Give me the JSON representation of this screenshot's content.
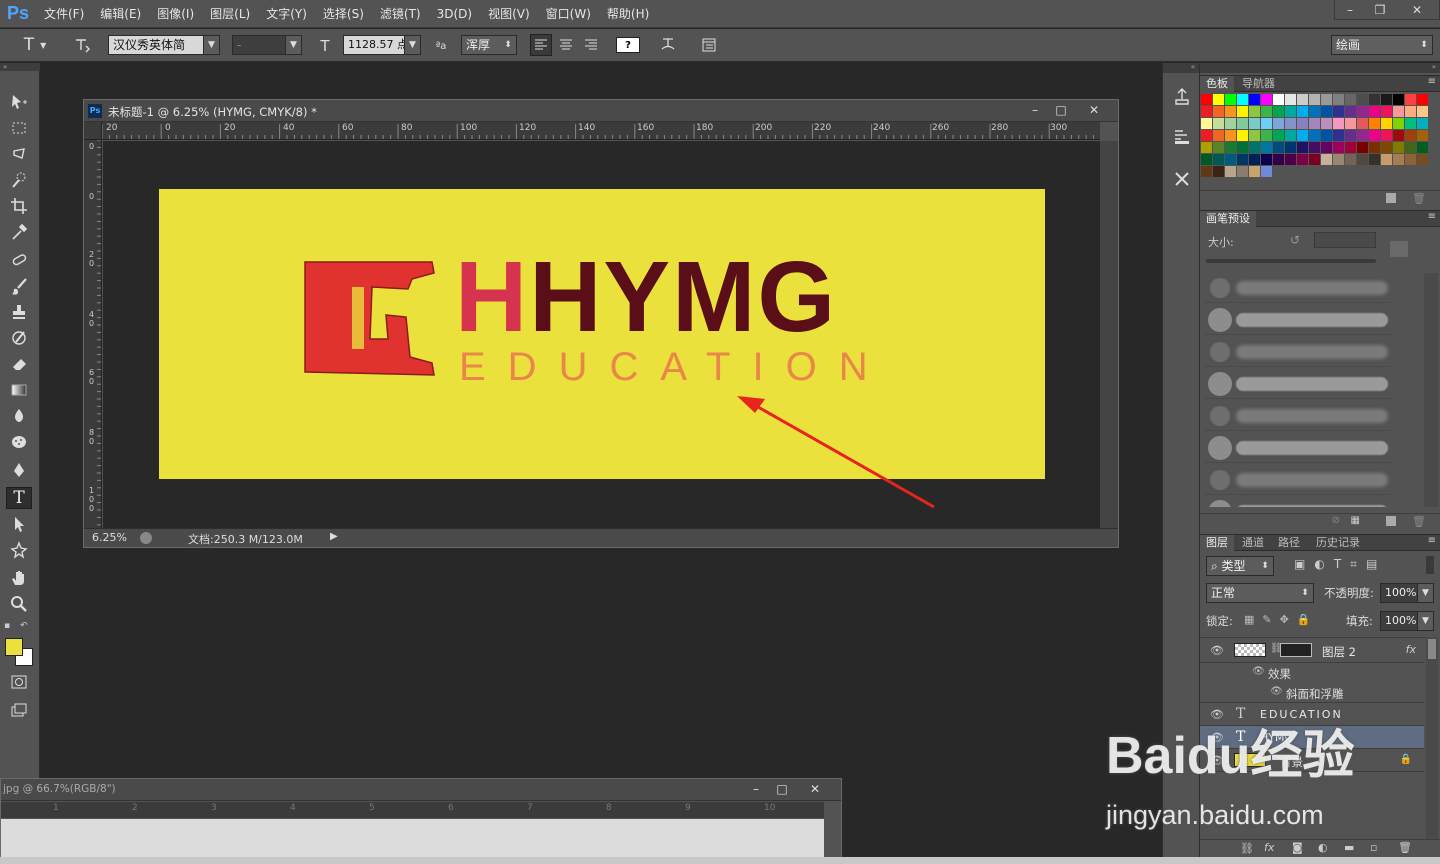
{
  "app": {
    "logo": "Ps",
    "menu": [
      "文件(F)",
      "编辑(E)",
      "图像(I)",
      "图层(L)",
      "文字(Y)",
      "选择(S)",
      "滤镜(T)",
      "3D(D)",
      "视图(V)",
      "窗口(W)",
      "帮助(H)"
    ],
    "window_controls": [
      "–",
      "❐",
      "✕"
    ]
  },
  "options": {
    "tool_glyph": "T",
    "font_family": "汉仪秀英体简",
    "font_style": "-",
    "font_size": "1128.57 点",
    "aa_glyph": "ªa",
    "anti_alias": "浑厚",
    "warp_box": "?",
    "workspace": "绘画"
  },
  "document": {
    "title": "未标题-1 @ 6.25% (HYMG, CMYK/8) *",
    "icon": "Ps",
    "zoom": "6.25%",
    "doc_info": "文档:250.3 M/123.0M",
    "ruler_h": [
      "20",
      "0",
      "20",
      "40",
      "60",
      "80",
      "100",
      "120",
      "140",
      "160",
      "180",
      "200",
      "220",
      "240",
      "260",
      "280",
      "300"
    ],
    "ruler_v": [
      "0",
      "0",
      "2\n0",
      "4\n0",
      "6\n0",
      "8\n0",
      "1\n0\n0"
    ],
    "artwork": {
      "brand": "HYMG",
      "sub": "EDUCATION",
      "bg_color": "#ebe13c",
      "text_color": "#5a0e18",
      "accent_color": "#d6334e",
      "sub_color": "#e9864a"
    }
  },
  "document2": {
    "title": "jpg @ 66.7%(RGB/8\")",
    "ruler": [
      "1",
      "2",
      "3",
      "4",
      "5",
      "6",
      "7",
      "8",
      "9",
      "10"
    ]
  },
  "panels": {
    "swatches_tabs": [
      "色板",
      "导航器"
    ],
    "brush_tab": "画笔预设",
    "brush_size_label": "大小:",
    "layers_tabs": [
      "图层",
      "通道",
      "路径",
      "历史记录"
    ],
    "filter_kind": "类型",
    "blend_mode": "正常",
    "opacity_label": "不透明度:",
    "opacity_value": "100%",
    "lock_label": "锁定:",
    "fill_label": "填充:",
    "fill_value": "100%",
    "layers": [
      {
        "name": "图层 2",
        "fx": "fx"
      },
      {
        "name": "效果"
      },
      {
        "name": "斜面和浮雕"
      },
      {
        "name": "EDUCATION"
      },
      {
        "name": "HYMG"
      },
      {
        "name": "背景"
      }
    ]
  },
  "watermark": {
    "brand": "Baidu经验",
    "url": "jingyan.baidu.com"
  }
}
